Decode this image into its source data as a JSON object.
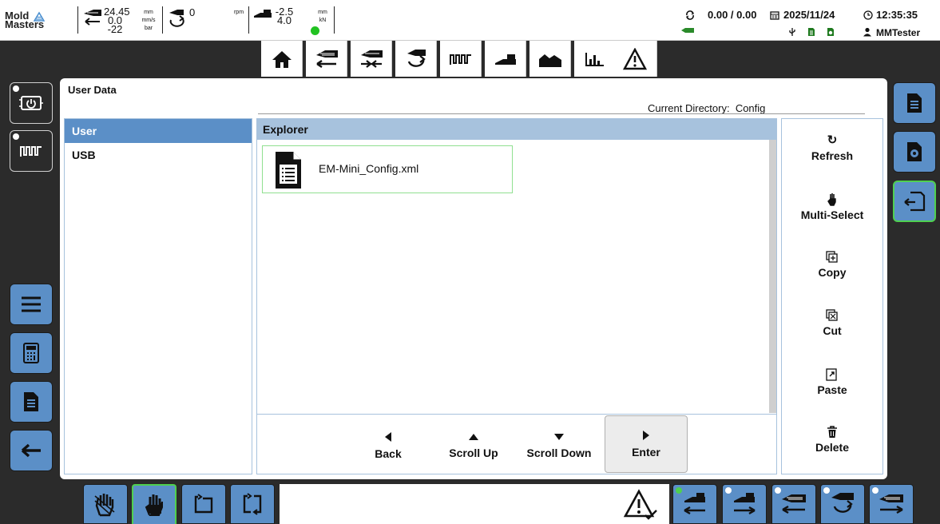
{
  "topbar": {
    "brand_line1": "Mold",
    "brand_line2": "Masters",
    "screw_pos": "24.45",
    "screw_speed": "0.0",
    "screw_pressure": "-22",
    "unit_mm": "mm",
    "unit_mms": "mm/s",
    "unit_bar": "bar",
    "rotation": "0",
    "unit_rpm": "rpm",
    "carriage_pos": "-2.5",
    "carriage_force": "4.0",
    "unit_mm2": "mm",
    "unit_kn": "kN",
    "cycle_time": "0.00 / 0.00",
    "date": "2025/11/24",
    "time": "12:35:35",
    "user": "MMTester",
    "status_led_color": "#22c222"
  },
  "nav": {
    "items": [
      "home-icon",
      "injection-icon",
      "hold-icon",
      "rotation-icon",
      "heater-icon",
      "carriage-icon",
      "profile-icon",
      "chart-icon",
      "alarm-icon"
    ]
  },
  "left_side": {
    "top": [
      "power-panel-icon",
      "heater-panel-icon"
    ],
    "bottom": [
      "menu-icon",
      "calculator-icon",
      "document-icon",
      "back-arrow-icon"
    ]
  },
  "right_side": [
    "document-icon",
    "settings-document-icon",
    "export-icon"
  ],
  "panel": {
    "title": "User Data",
    "current_dir_label": "Current Directory:",
    "current_dir": "Config"
  },
  "locations": [
    {
      "label": "User",
      "selected": true
    },
    {
      "label": "USB",
      "selected": false
    }
  ],
  "explorer": {
    "header": "Explorer",
    "files": [
      {
        "name": "EM-Mini_Config.xml"
      }
    ]
  },
  "nav_actions": {
    "back": "Back",
    "scroll_up": "Scroll Up",
    "scroll_down": "Scroll Down",
    "enter": "Enter"
  },
  "actions": {
    "refresh": "Refresh",
    "multi_select": "Multi-Select",
    "copy": "Copy",
    "cut": "Cut",
    "paste": "Paste",
    "delete": "Delete"
  },
  "bottom": {
    "left_buttons": [
      "manual-gloves-icon",
      "manual-hand-icon",
      "single-cycle-icon",
      "auto-cycle-icon"
    ],
    "right_buttons": [
      "carriage-back-icon",
      "carriage-forward-icon",
      "injection-back-icon",
      "rotation-back-icon",
      "injection-forward-icon"
    ]
  }
}
